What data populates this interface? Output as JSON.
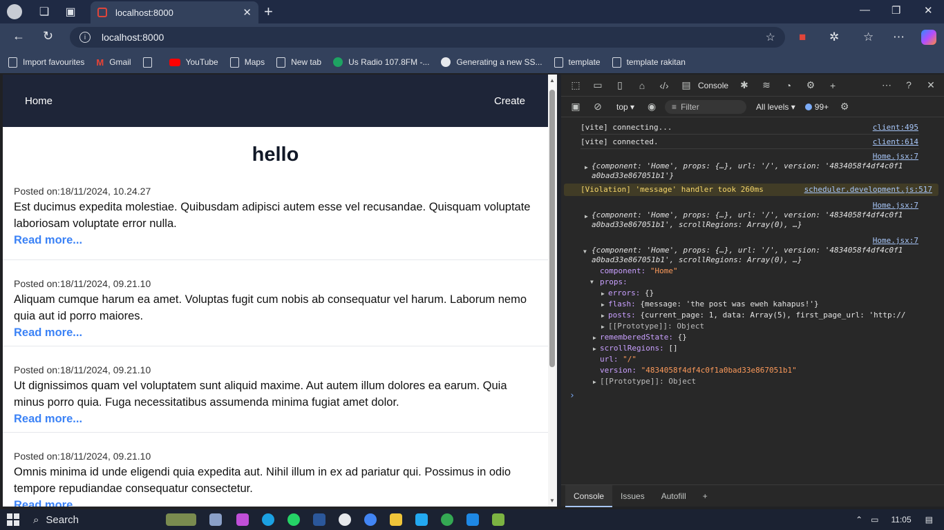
{
  "browser": {
    "tab_title": "localhost:8000",
    "url": "localhost:8000",
    "bookmarks": [
      {
        "label": "Import favourites",
        "icon": "import-icon"
      },
      {
        "label": "Gmail",
        "icon": "gmail-icon"
      },
      {
        "label": "",
        "icon": "page-icon"
      },
      {
        "label": "YouTube",
        "icon": "youtube-icon"
      },
      {
        "label": "Maps",
        "icon": "page-icon"
      },
      {
        "label": "New tab",
        "icon": "page-icon"
      },
      {
        "label": "Us Radio 107.8FM -...",
        "icon": "radio-icon"
      },
      {
        "label": "Generating a new SS...",
        "icon": "github-icon"
      },
      {
        "label": "template",
        "icon": "page-icon"
      },
      {
        "label": "template rakitan",
        "icon": "page-icon"
      }
    ]
  },
  "app": {
    "nav_home": "Home",
    "nav_create": "Create",
    "title": "hello",
    "posts": [
      {
        "date": "Posted on:18/11/2024, 10.24.27",
        "body": "Est ducimus expedita molestiae. Quibusdam adipisci autem esse vel recusandae. Quisquam voluptate laboriosam voluptate error nulla.",
        "more": "Read more..."
      },
      {
        "date": "Posted on:18/11/2024, 09.21.10",
        "body": "Aliquam cumque harum ea amet. Voluptas fugit cum nobis ab consequatur vel harum. Laborum nemo quia aut id porro maiores.",
        "more": "Read more..."
      },
      {
        "date": "Posted on:18/11/2024, 09.21.10",
        "body": "Ut dignissimos quam vel voluptatem sunt aliquid maxime. Aut autem illum dolores ea earum. Quia minus porro quia. Fuga necessitatibus assumenda minima fugiat amet dolor.",
        "more": "Read more..."
      },
      {
        "date": "Posted on:18/11/2024, 09.21.10",
        "body": "Omnis minima id unde eligendi quia expedita aut. Nihil illum in ex ad pariatur qui. Possimus in odio tempore repudiandae consequatur consectetur.",
        "more": "Read more..."
      }
    ]
  },
  "devtools": {
    "console_tab": "Console",
    "context": "top",
    "filter_placeholder": "Filter",
    "levels": "All levels",
    "issues_count": "99+",
    "logs": {
      "vite_connecting": "[vite] connecting...",
      "vite_connecting_src": "client:495",
      "vite_connected": "[vite] connected.",
      "vite_connected_src": "client:614",
      "home_src": "Home.jsx:7",
      "obj1_line1": "{component: 'Home', props: {…}, url: '/', version: '4834058f4df4c0f1",
      "obj1_line2": "a0bad33e867051b1'}",
      "violation": "[Violation] 'message' handler took 260ms",
      "violation_src": "scheduler.development.js:517",
      "obj2_line1": "{component: 'Home', props: {…}, url: '/', version: '4834058f4df4c0f1",
      "obj2_line2": "a0bad33e867051b1', scrollRegions: Array(0), …}",
      "obj3_line1": "{component: 'Home', props: {…}, url: '/', version: '4834058f4df4c0f1",
      "obj3_line2": "a0bad33e867051b1', scrollRegions: Array(0), …}",
      "component_key": "component:",
      "component_val": "\"Home\"",
      "props_key": "props:",
      "errors_key": "errors:",
      "errors_val": "{}",
      "flash_key": "flash:",
      "flash_val": "{message: 'the post was eweh kahapus!'}",
      "posts_key": "posts:",
      "posts_val": "{current_page: 1, data: Array(5), first_page_url: 'http://",
      "proto_inner": "[[Prototype]]: Object",
      "remembered_key": "rememberedState:",
      "remembered_val": "{}",
      "scroll_key": "scrollRegions:",
      "scroll_val": "[]",
      "url_key": "url:",
      "url_val": "\"/\"",
      "version_key": "version:",
      "version_val": "\"4834058f4df4c0f1a0bad33e867051b1\"",
      "proto_outer": "[[Prototype]]: Object"
    },
    "drawer_tabs": [
      "Console",
      "Issues",
      "Autofill"
    ]
  },
  "taskbar": {
    "search_label": "Search",
    "time": "11:05"
  }
}
